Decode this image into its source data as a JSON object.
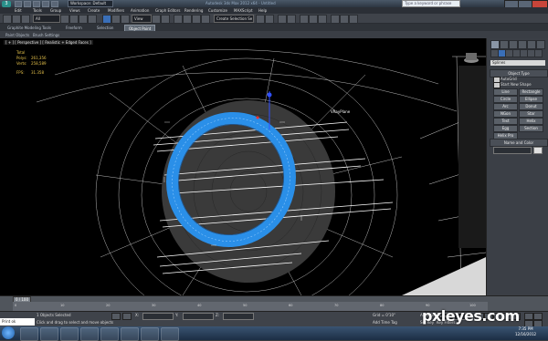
{
  "window": {
    "title": "Autodesk 3ds Max 2012 x64 - Untitled",
    "workspace": "Workspace: Default",
    "search_placeholder": "Type a keyword or phrase"
  },
  "menus": [
    "Edit",
    "Tools",
    "Group",
    "Views",
    "Create",
    "Modifiers",
    "Animation",
    "Graph Editors",
    "Rendering",
    "Customize",
    "MAXScript",
    "Help"
  ],
  "toolbar": {
    "selection_filter": "All",
    "view_ref": "View",
    "named_sets": "Create Selection Se"
  },
  "ribbon": {
    "tabs": [
      "Graphite Modeling Tools",
      "Freeform",
      "Selection",
      "Object Paint"
    ],
    "active_tab": "Object Paint",
    "sub_items": [
      "Paint Objects",
      "Brush Settings"
    ]
  },
  "viewport": {
    "label": "[ + ] [ Perspective ] [ Realistic + Edged Faces ]",
    "stats": {
      "title": "Total",
      "polys_label": "Polys:",
      "polys": "261,356",
      "verts_label": "Verts:",
      "verts": "258,589",
      "fps_label": "FPS:",
      "fps": "31.358"
    },
    "object_label": "VRayPlane"
  },
  "command_panel": {
    "category": "Splines",
    "object_type_header": "Object Type",
    "autogrid": "AutoGrid",
    "start_new_shape": "Start New Shape",
    "buttons": [
      "Line",
      "Rectangle",
      "Circle",
      "Ellipse",
      "Arc",
      "Donut",
      "NGon",
      "Star",
      "Text",
      "Helix",
      "Egg",
      "Section",
      "Helix Pro"
    ],
    "name_color_header": "Name and Color"
  },
  "timeline": {
    "slider": "0 / 100",
    "ticks": [
      "0",
      "10",
      "20",
      "30",
      "40",
      "50",
      "60",
      "70",
      "80",
      "90",
      "100"
    ]
  },
  "status": {
    "maxscript": "Print ok",
    "selected": "1 Objects Selected",
    "prompt": "Click and drag to select and move objects",
    "coords": {
      "x": "X:",
      "y": "Y:",
      "z": "Z:"
    },
    "grid": "Grid = 0'10\"",
    "add_time_tag": "Add Time Tag",
    "auto_key": "Auto Key",
    "set_key": "Set Key",
    "key_mode": "Selected",
    "key_filters": "Key Filters..."
  },
  "taskbar": {
    "time": "7:35 PM",
    "date": "12/16/2012"
  },
  "watermark": "pxleyes.com",
  "colors": {
    "accent": "#3a6fb8",
    "torus": "#2a8fe8",
    "viewport_bg": "#000000"
  }
}
